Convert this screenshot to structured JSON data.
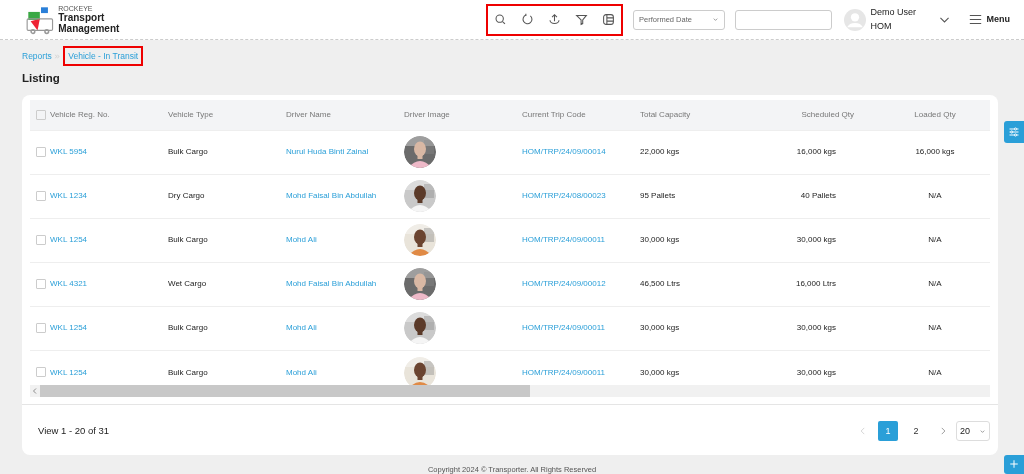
{
  "header": {
    "brand_small": "ROCKEYE",
    "brand_title": "Transport Management",
    "toolbar": {
      "highlighted": true
    },
    "date_select": {
      "value": "Performed Date"
    },
    "user": {
      "name": "Demo User",
      "branch": "HOM"
    },
    "menu_label": "Menu"
  },
  "breadcrumb": [
    {
      "label": "Reports",
      "highlighted": false
    },
    {
      "label": "Vehicle - In Transit",
      "highlighted": true
    }
  ],
  "page_title": "Listing",
  "table": {
    "select_all_checked": false,
    "columns": [
      "Vehicle Reg. No.",
      "Vehicle Type",
      "Driver Name",
      "Driver Image",
      "Current Trip Code",
      "Total Capacity",
      "Scheduled Qty",
      "Loaded Qty"
    ],
    "rows": [
      {
        "checked": false,
        "reg": "WKL 5954",
        "type": "Bulk Cargo",
        "driver": "Nurul Huda Binti Zainal",
        "trip": "HOM/TRP/24/09/00014",
        "capacity": "22,000 kgs",
        "scheduled": "16,000 kgs",
        "loaded": "16,000 kgs"
      },
      {
        "checked": false,
        "reg": "WKL 1234",
        "type": "Dry Cargo",
        "driver": "Mohd Faisal Bin Abdullah",
        "trip": "HOM/TRP/24/08/00023",
        "capacity": "95 Pallets",
        "scheduled": "40 Pallets",
        "loaded": "N/A"
      },
      {
        "checked": false,
        "reg": "WKL 1254",
        "type": "Bulk Cargo",
        "driver": "Mohd Ali",
        "trip": "HOM/TRP/24/09/00011",
        "capacity": "30,000 kgs",
        "scheduled": "30,000 kgs",
        "loaded": "N/A"
      },
      {
        "checked": false,
        "reg": "WKL 4321",
        "type": "Wet Cargo",
        "driver": "Mohd Faisal Bin Abdullah",
        "trip": "HOM/TRP/24/09/00012",
        "capacity": "46,500 Ltrs",
        "scheduled": "16,000 Ltrs",
        "loaded": "N/A"
      },
      {
        "checked": false,
        "reg": "WKL 1254",
        "type": "Bulk Cargo",
        "driver": "Mohd Ali",
        "trip": "HOM/TRP/24/09/00011",
        "capacity": "30,000 kgs",
        "scheduled": "30,000 kgs",
        "loaded": "N/A"
      },
      {
        "checked": false,
        "reg": "WKL 1254",
        "type": "Bulk Cargo",
        "driver": "Mohd Ali",
        "trip": "HOM/TRP/24/09/00011",
        "capacity": "30,000 kgs",
        "scheduled": "30,000 kgs",
        "loaded": "N/A"
      }
    ]
  },
  "pagination": {
    "summary": "View 1 - 20 of 31",
    "pages": [
      {
        "label": "1",
        "selected": true
      },
      {
        "label": "2",
        "selected": false
      }
    ],
    "page_size": "20"
  },
  "footer": {
    "copyright": "Copyright 2024 © Transporter. All Rights Reserved"
  }
}
